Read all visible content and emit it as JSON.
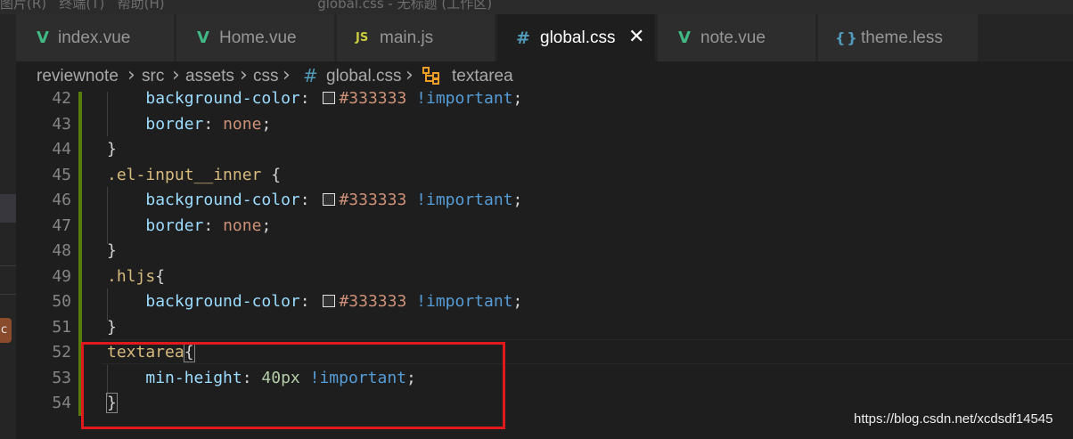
{
  "titlebar": {
    "partial_text": "图片(R)   终端(T)   帮助(H)                                    global.css - 无标题 (工作区)"
  },
  "activitybar": {
    "badge_text": "c"
  },
  "tabs": [
    {
      "label": "index.vue",
      "icon": "vue-icon",
      "active": false
    },
    {
      "label": "Home.vue",
      "icon": "vue-icon",
      "active": false
    },
    {
      "label": "main.js",
      "icon": "js-icon",
      "active": false
    },
    {
      "label": "global.css",
      "icon": "css-icon",
      "active": true
    },
    {
      "label": "note.vue",
      "icon": "vue-icon",
      "active": false
    },
    {
      "label": "theme.less",
      "icon": "less-icon",
      "active": false
    }
  ],
  "icon_glyphs": {
    "vue": "V",
    "js": "JS",
    "css": "#",
    "less": "{}",
    "close": "✕",
    "chevron": "›"
  },
  "breadcrumb": {
    "items": [
      "reviewnote",
      "src",
      "assets",
      "css",
      "global.css",
      "textarea"
    ],
    "file_icon": "css-hash-icon",
    "symbol_icon": "symbol-class-icon"
  },
  "editor": {
    "lines": [
      {
        "n": "42",
        "indent": 1,
        "prop": "background-color",
        "color": "#333333",
        "important": "!important"
      },
      {
        "n": "43",
        "indent": 1,
        "prop": "border",
        "value": "none"
      },
      {
        "n": "44",
        "indent": 0,
        "text": "}"
      },
      {
        "n": "45",
        "indent": 0,
        "selector": ".el-input__inner",
        "open": " {"
      },
      {
        "n": "46",
        "indent": 1,
        "prop": "background-color",
        "color": "#333333",
        "important": "!important"
      },
      {
        "n": "47",
        "indent": 1,
        "prop": "border",
        "value": "none"
      },
      {
        "n": "48",
        "indent": 0,
        "text": "}"
      },
      {
        "n": "49",
        "indent": 0,
        "selector": ".hljs",
        "open": "{"
      },
      {
        "n": "50",
        "indent": 1,
        "prop": "background-color",
        "color": "#333333",
        "important": "!important"
      },
      {
        "n": "51",
        "indent": 0,
        "text": "}"
      },
      {
        "n": "52",
        "indent": 0,
        "selector": "textarea",
        "open": "{"
      },
      {
        "n": "53",
        "indent": 1,
        "prop": "min-height",
        "number": "40px",
        "important": "!important"
      },
      {
        "n": "54",
        "indent": 0,
        "text": "}"
      }
    ]
  },
  "colors": {
    "editor_bg": "#1e1e1e",
    "tab_inactive_bg": "#2d2d2d",
    "highlight_box": "#e0191c",
    "git_modified_gutter": "#587c0c"
  },
  "watermark": "https://blog.csdn.net/xcdsdf14545"
}
